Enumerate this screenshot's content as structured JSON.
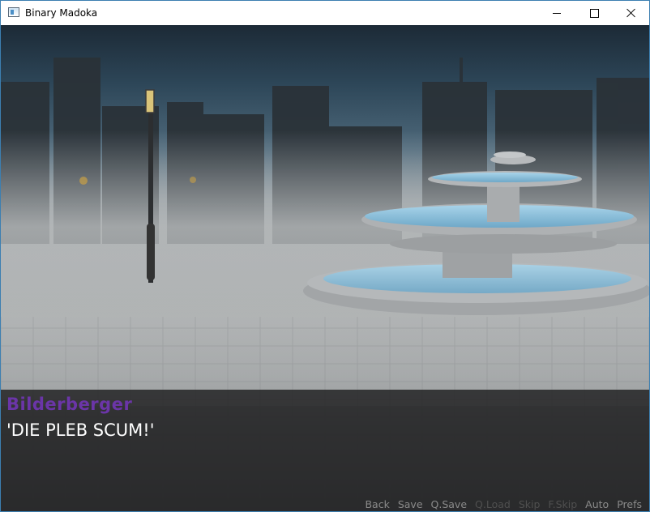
{
  "window": {
    "title": "Binary Madoka",
    "icon": "app-window-icon"
  },
  "dialogue": {
    "speaker": "Bilderberger",
    "text": "'DIE PLEB SCUM!'",
    "speaker_color": "#6b35a8"
  },
  "quick_menu": [
    {
      "label": "Back",
      "enabled": true
    },
    {
      "label": "Save",
      "enabled": true
    },
    {
      "label": "Q.Save",
      "enabled": true
    },
    {
      "label": "Q.Load",
      "enabled": false
    },
    {
      "label": "Skip",
      "enabled": false
    },
    {
      "label": "F.Skip",
      "enabled": false
    },
    {
      "label": "Auto",
      "enabled": true
    },
    {
      "label": "Prefs",
      "enabled": true
    }
  ]
}
